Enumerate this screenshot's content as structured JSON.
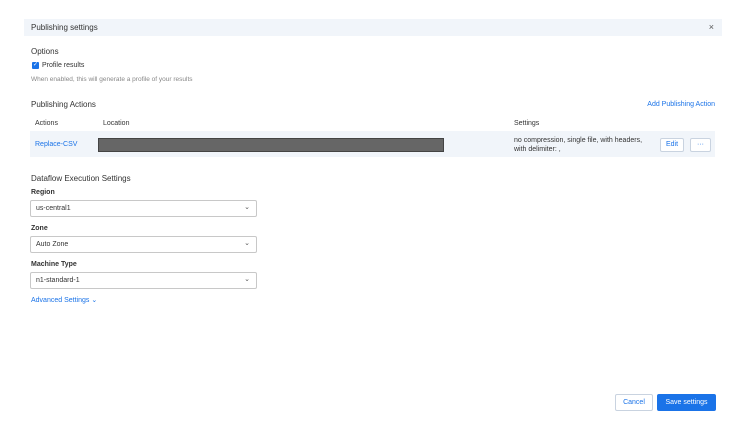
{
  "dialog": {
    "title": "Publishing settings",
    "close_icon": "×"
  },
  "options": {
    "heading": "Options",
    "profile_label": "Profile results",
    "profile_checked": true,
    "help": "When enabled, this will generate a profile of your results"
  },
  "publishing": {
    "heading": "Publishing Actions",
    "add_label": "Add Publishing Action",
    "columns": [
      "Actions",
      "Location",
      "Settings"
    ],
    "rows": [
      {
        "action": "Replace-CSV",
        "settings": "no compression, single file, with headers, with delimiter: ,",
        "edit": "Edit",
        "more": "···"
      }
    ]
  },
  "dataflow": {
    "heading": "Dataflow Execution Settings",
    "region": {
      "label": "Region",
      "value": "us-central1"
    },
    "zone": {
      "label": "Zone",
      "value": "Auto Zone"
    },
    "machine": {
      "label": "Machine Type",
      "value": "n1-standard-1"
    },
    "advanced": "Advanced Settings"
  },
  "footer": {
    "cancel": "Cancel",
    "save": "Save settings"
  }
}
